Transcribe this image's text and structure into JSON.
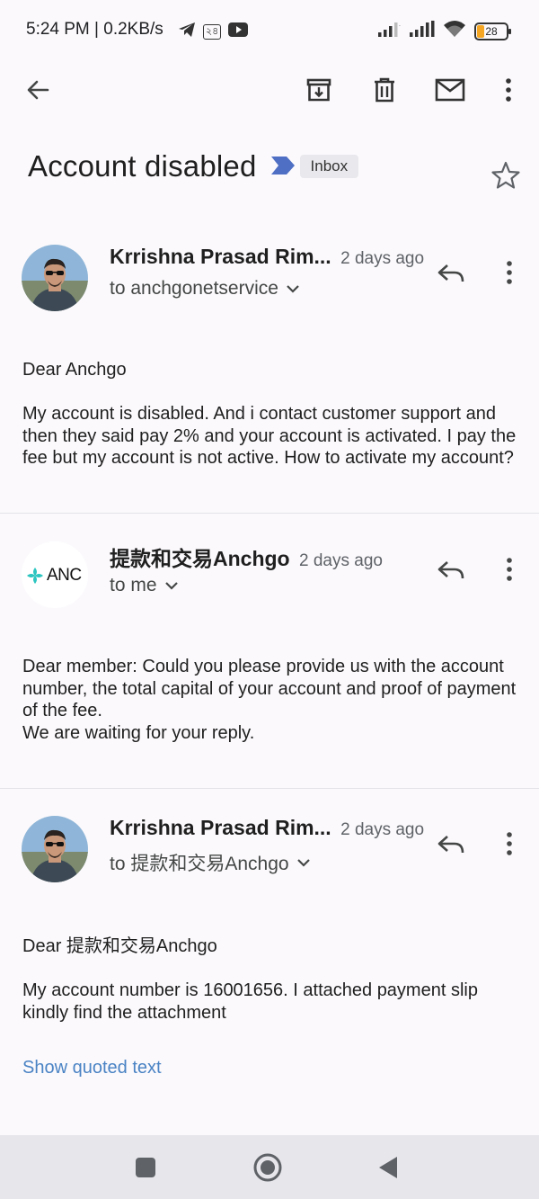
{
  "status_bar": {
    "time": "5:24 PM",
    "separator": "|",
    "speed": "0.2KB/s",
    "icons": [
      "telegram-icon",
      "app-notification-icon",
      "youtube-icon"
    ],
    "app_badge": "২৪",
    "battery_level": "28",
    "signal_icons": [
      "signal-icon",
      "signal-icon",
      "wifi-icon"
    ]
  },
  "toolbar": {
    "back": "back-arrow-icon",
    "actions": [
      "archive-icon",
      "delete-icon",
      "mark-unread-icon",
      "more-vert-icon"
    ]
  },
  "thread": {
    "subject": "Account disabled",
    "label": "Inbox",
    "starred": false
  },
  "messages": [
    {
      "sender": "Krrishna Prasad Rim...",
      "date": "2 days ago",
      "recipient": "to anchgonetservice",
      "paragraphs": [
        "Dear Anchgo",
        "My account is disabled. And i contact customer support and then they said pay 2% and your account is activated. I pay the fee but my account is not active. How to activate my account?"
      ]
    },
    {
      "sender": "提款和交易Anchgo",
      "date": "2 days ago",
      "recipient": "to me",
      "avatar_text": "ANC",
      "paragraphs": [
        "Dear member: Could you please provide us with the account number, the total capital of your account and proof of payment of the fee.",
        "We are waiting for your reply."
      ]
    },
    {
      "sender": "Krrishna Prasad Rim...",
      "date": "2 days ago",
      "recipient": "to 提款和交易Anchgo",
      "paragraphs": [
        "Dear 提款和交易Anchgo",
        "My account number is 16001656. I attached payment slip kindly find the attachment"
      ],
      "show_quoted": "Show quoted text"
    }
  ],
  "nav_bar": {
    "buttons": [
      "recents-square-icon",
      "home-circle-icon",
      "back-triangle-icon"
    ]
  },
  "colors": {
    "background": "#fbf9fc",
    "link": "#4a83c4",
    "important_marker": "#4e6fc4",
    "nav_bar": "#e7e6eb"
  }
}
